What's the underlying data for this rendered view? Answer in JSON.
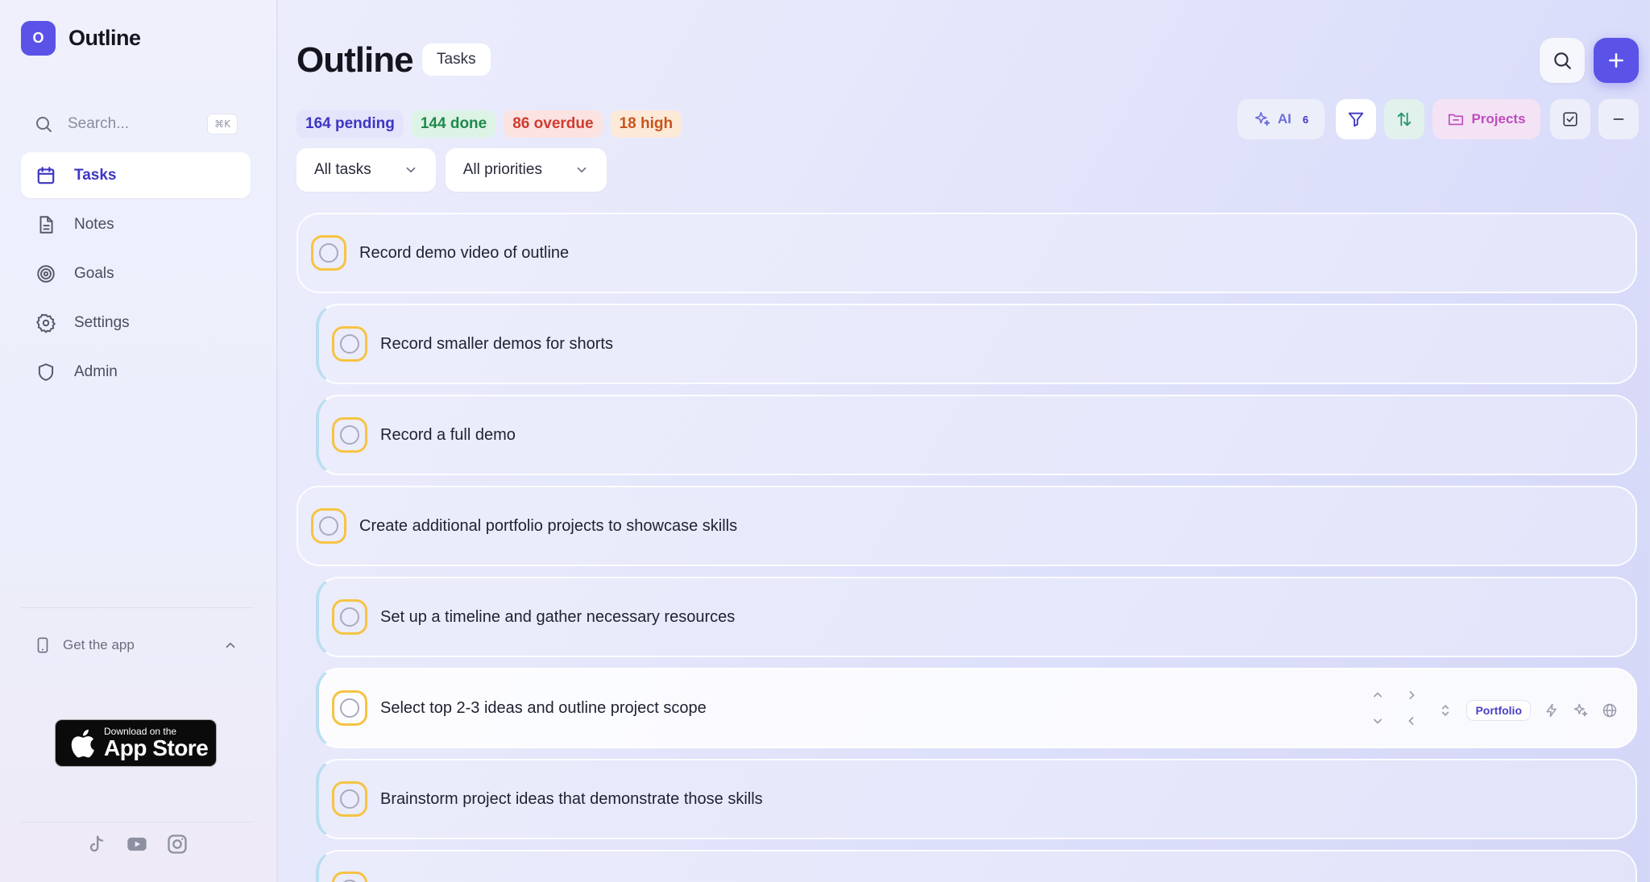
{
  "app": {
    "logo_letter": "O",
    "name": "Outline"
  },
  "sidebar": {
    "search_placeholder": "Search...",
    "search_shortcut": "⌘K",
    "items": [
      {
        "label": "Tasks",
        "icon": "calendar-icon",
        "active": true
      },
      {
        "label": "Notes",
        "icon": "document-icon",
        "active": false
      },
      {
        "label": "Goals",
        "icon": "target-icon",
        "active": false
      },
      {
        "label": "Settings",
        "icon": "gear-icon",
        "active": false
      },
      {
        "label": "Admin",
        "icon": "shield-icon",
        "active": false
      }
    ],
    "get_app_label": "Get the app",
    "appstore": {
      "small": "Download on the",
      "big": "App Store"
    },
    "socials": [
      "tiktok-icon",
      "youtube-icon",
      "instagram-icon"
    ]
  },
  "header": {
    "title": "Outline",
    "chip": "Tasks",
    "stats": [
      {
        "label": "164 pending",
        "color": "#3d36c2",
        "bg": "#e4e4fb"
      },
      {
        "label": "144 done",
        "color": "#1f8a4a",
        "bg": "#ddf3e6"
      },
      {
        "label": "86 overdue",
        "color": "#d03b2f",
        "bg": "#fbe3e2"
      },
      {
        "label": "18 high",
        "color": "#c8551e",
        "bg": "#fde9d7"
      }
    ],
    "filters": {
      "status": "All tasks",
      "priority": "All priorities"
    }
  },
  "toolbar": {
    "ai_label": "AI",
    "ai_count": "6",
    "projects_label": "Projects"
  },
  "tasks": [
    {
      "text": "Record demo video of outline",
      "level": 0
    },
    {
      "text": "Record smaller demos for shorts",
      "level": 1
    },
    {
      "text": "Record a full demo",
      "level": 1
    },
    {
      "text": "Create additional portfolio projects to showcase skills",
      "level": 0
    },
    {
      "text": "Set up a timeline and gather necessary resources",
      "level": 1
    },
    {
      "text": "Select top 2-3 ideas and outline project scope",
      "level": 1,
      "tag": "Portfolio"
    },
    {
      "text": "Brainstorm project ideas that demonstrate those skills",
      "level": 1
    }
  ],
  "colors": {
    "accent": "#5b52e8",
    "checkbox_border": "#f6c343",
    "projects": "#c04bbd"
  }
}
